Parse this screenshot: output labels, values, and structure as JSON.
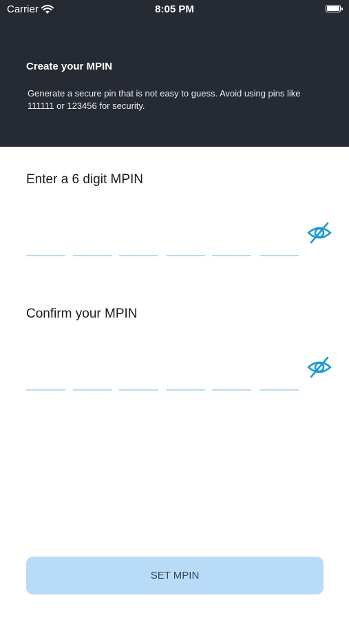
{
  "status_bar": {
    "carrier": "Carrier",
    "time": "8:05 PM"
  },
  "header": {
    "title": "Create your MPIN",
    "description": "Generate a secure pin that is not easy to guess. Avoid using pins like 111111 or 123456 for security."
  },
  "mpin": {
    "label": "Enter a 6 digit MPIN",
    "digits": [
      "",
      "",
      "",
      "",
      "",
      ""
    ]
  },
  "confirm": {
    "label": "Confirm your MPIN",
    "digits": [
      "",
      "",
      "",
      "",
      "",
      ""
    ]
  },
  "submit": {
    "label": "SET MPIN"
  },
  "colors": {
    "header_bg": "#262a32",
    "accent": "#1a9ad6",
    "slot_underline": "#b8dcf2",
    "button_bg": "#b8dcf7"
  },
  "icons": {
    "visibility_toggle": "eye-off-icon"
  }
}
